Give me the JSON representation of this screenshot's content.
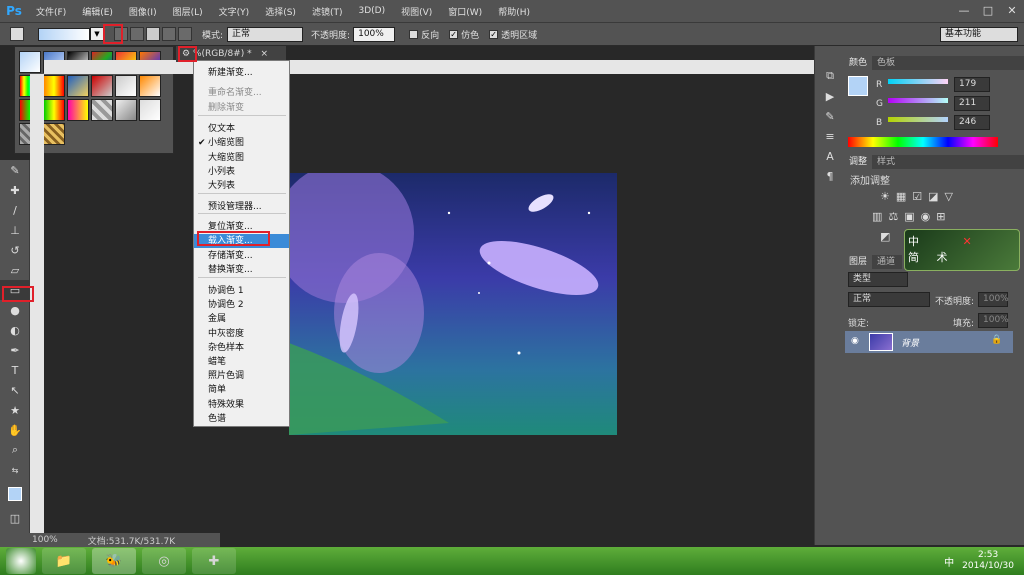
{
  "app": {
    "logo": "Ps"
  },
  "menu": [
    "文件(F)",
    "编辑(E)",
    "图像(I)",
    "图层(L)",
    "文字(Y)",
    "选择(S)",
    "滤镜(T)",
    "3D(D)",
    "视图(V)",
    "窗口(W)",
    "帮助(H)"
  ],
  "window_buttons": [
    "—",
    "□",
    "✕"
  ],
  "options": {
    "mode_label": "模式:",
    "mode_value": "正常",
    "opacity_label": "不透明度:",
    "opacity_value": "100%",
    "reverse_label": "反向",
    "dither_label": "仿色",
    "transparency_label": "透明区域",
    "workspace": "基本功能"
  },
  "doc_tab": {
    "title": "%(RGB/8#) *",
    "close": "×"
  },
  "context_menu": {
    "items": [
      {
        "label": "新建渐变...",
        "state": "normal"
      },
      {
        "label": "重命名渐变...",
        "state": "disabled"
      },
      {
        "label": "删除渐变",
        "state": "disabled"
      },
      {
        "label": "仅文本",
        "state": "normal"
      },
      {
        "label": "小缩览图",
        "state": "checked"
      },
      {
        "label": "大缩览图",
        "state": "normal"
      },
      {
        "label": "小列表",
        "state": "normal"
      },
      {
        "label": "大列表",
        "state": "normal"
      },
      {
        "label": "预设管理器...",
        "state": "normal"
      },
      {
        "label": "复位渐变...",
        "state": "normal"
      },
      {
        "label": "载入渐变...",
        "state": "highlighted"
      },
      {
        "label": "存储渐变...",
        "state": "normal"
      },
      {
        "label": "替换渐变...",
        "state": "normal"
      },
      {
        "label": "协调色 1",
        "state": "normal"
      },
      {
        "label": "协调色 2",
        "state": "normal"
      },
      {
        "label": "金属",
        "state": "normal"
      },
      {
        "label": "中灰密度",
        "state": "normal"
      },
      {
        "label": "杂色样本",
        "state": "normal"
      },
      {
        "label": "蜡笔",
        "state": "normal"
      },
      {
        "label": "照片色调",
        "state": "normal"
      },
      {
        "label": "简单",
        "state": "normal"
      },
      {
        "label": "特殊效果",
        "state": "normal"
      },
      {
        "label": "色谱",
        "state": "normal"
      }
    ]
  },
  "panels": {
    "color_tabs": [
      "颜色",
      "色板"
    ],
    "color": {
      "r_label": "R",
      "r": "179",
      "g_label": "G",
      "g": "211",
      "b_label": "B",
      "b": "246"
    },
    "adjust_tabs": [
      "调整",
      "样式"
    ],
    "adjust_title": "添加调整",
    "layers_tabs": [
      "图层",
      "通道"
    ],
    "layers": {
      "kind": "类型",
      "blend": "正常",
      "opacity_label": "不透明度:",
      "opacity": "100%",
      "lock_label": "锁定:",
      "fill_label": "填充:",
      "fill": "100%",
      "layer_name": "背景"
    }
  },
  "ime_widget": {
    "text_1": "中",
    "text_2": "简",
    "text_3": "术"
  },
  "status": {
    "zoom": "100%",
    "doc": "文档:531.7K/531.7K"
  },
  "taskbar": {
    "time": "2:53",
    "date": "2014/10/30",
    "tray_ime": "中"
  },
  "colors": {
    "accent": "#3b8bd8",
    "highlight_box": "#e0202a",
    "panel_bg": "#535353"
  }
}
